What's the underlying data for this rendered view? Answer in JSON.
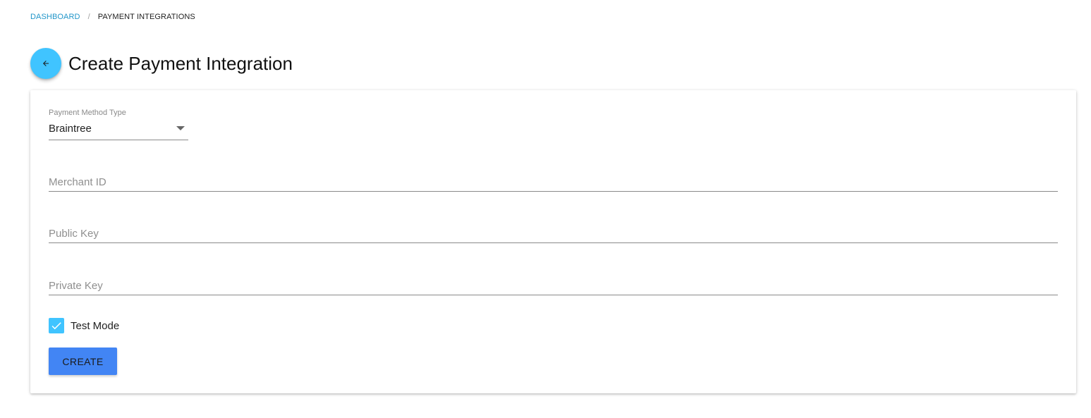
{
  "breadcrumb": {
    "items": [
      {
        "label": "DASHBOARD"
      },
      {
        "label": "PAYMENT INTEGRATIONS"
      }
    ],
    "separator": "/"
  },
  "header": {
    "back_icon": "arrow-left-icon",
    "title": "Create Payment Integration"
  },
  "form": {
    "payment_method": {
      "label": "Payment Method Type",
      "value": "Braintree"
    },
    "merchant_id": {
      "placeholder": "Merchant ID",
      "value": ""
    },
    "public_key": {
      "placeholder": "Public Key",
      "value": ""
    },
    "private_key": {
      "placeholder": "Private Key",
      "value": ""
    },
    "test_mode": {
      "label": "Test Mode",
      "checked": true
    },
    "submit_label": "CREATE"
  },
  "colors": {
    "accent": "#40c4ff",
    "primary_button": "#4285f4",
    "link": "#2196c9"
  }
}
